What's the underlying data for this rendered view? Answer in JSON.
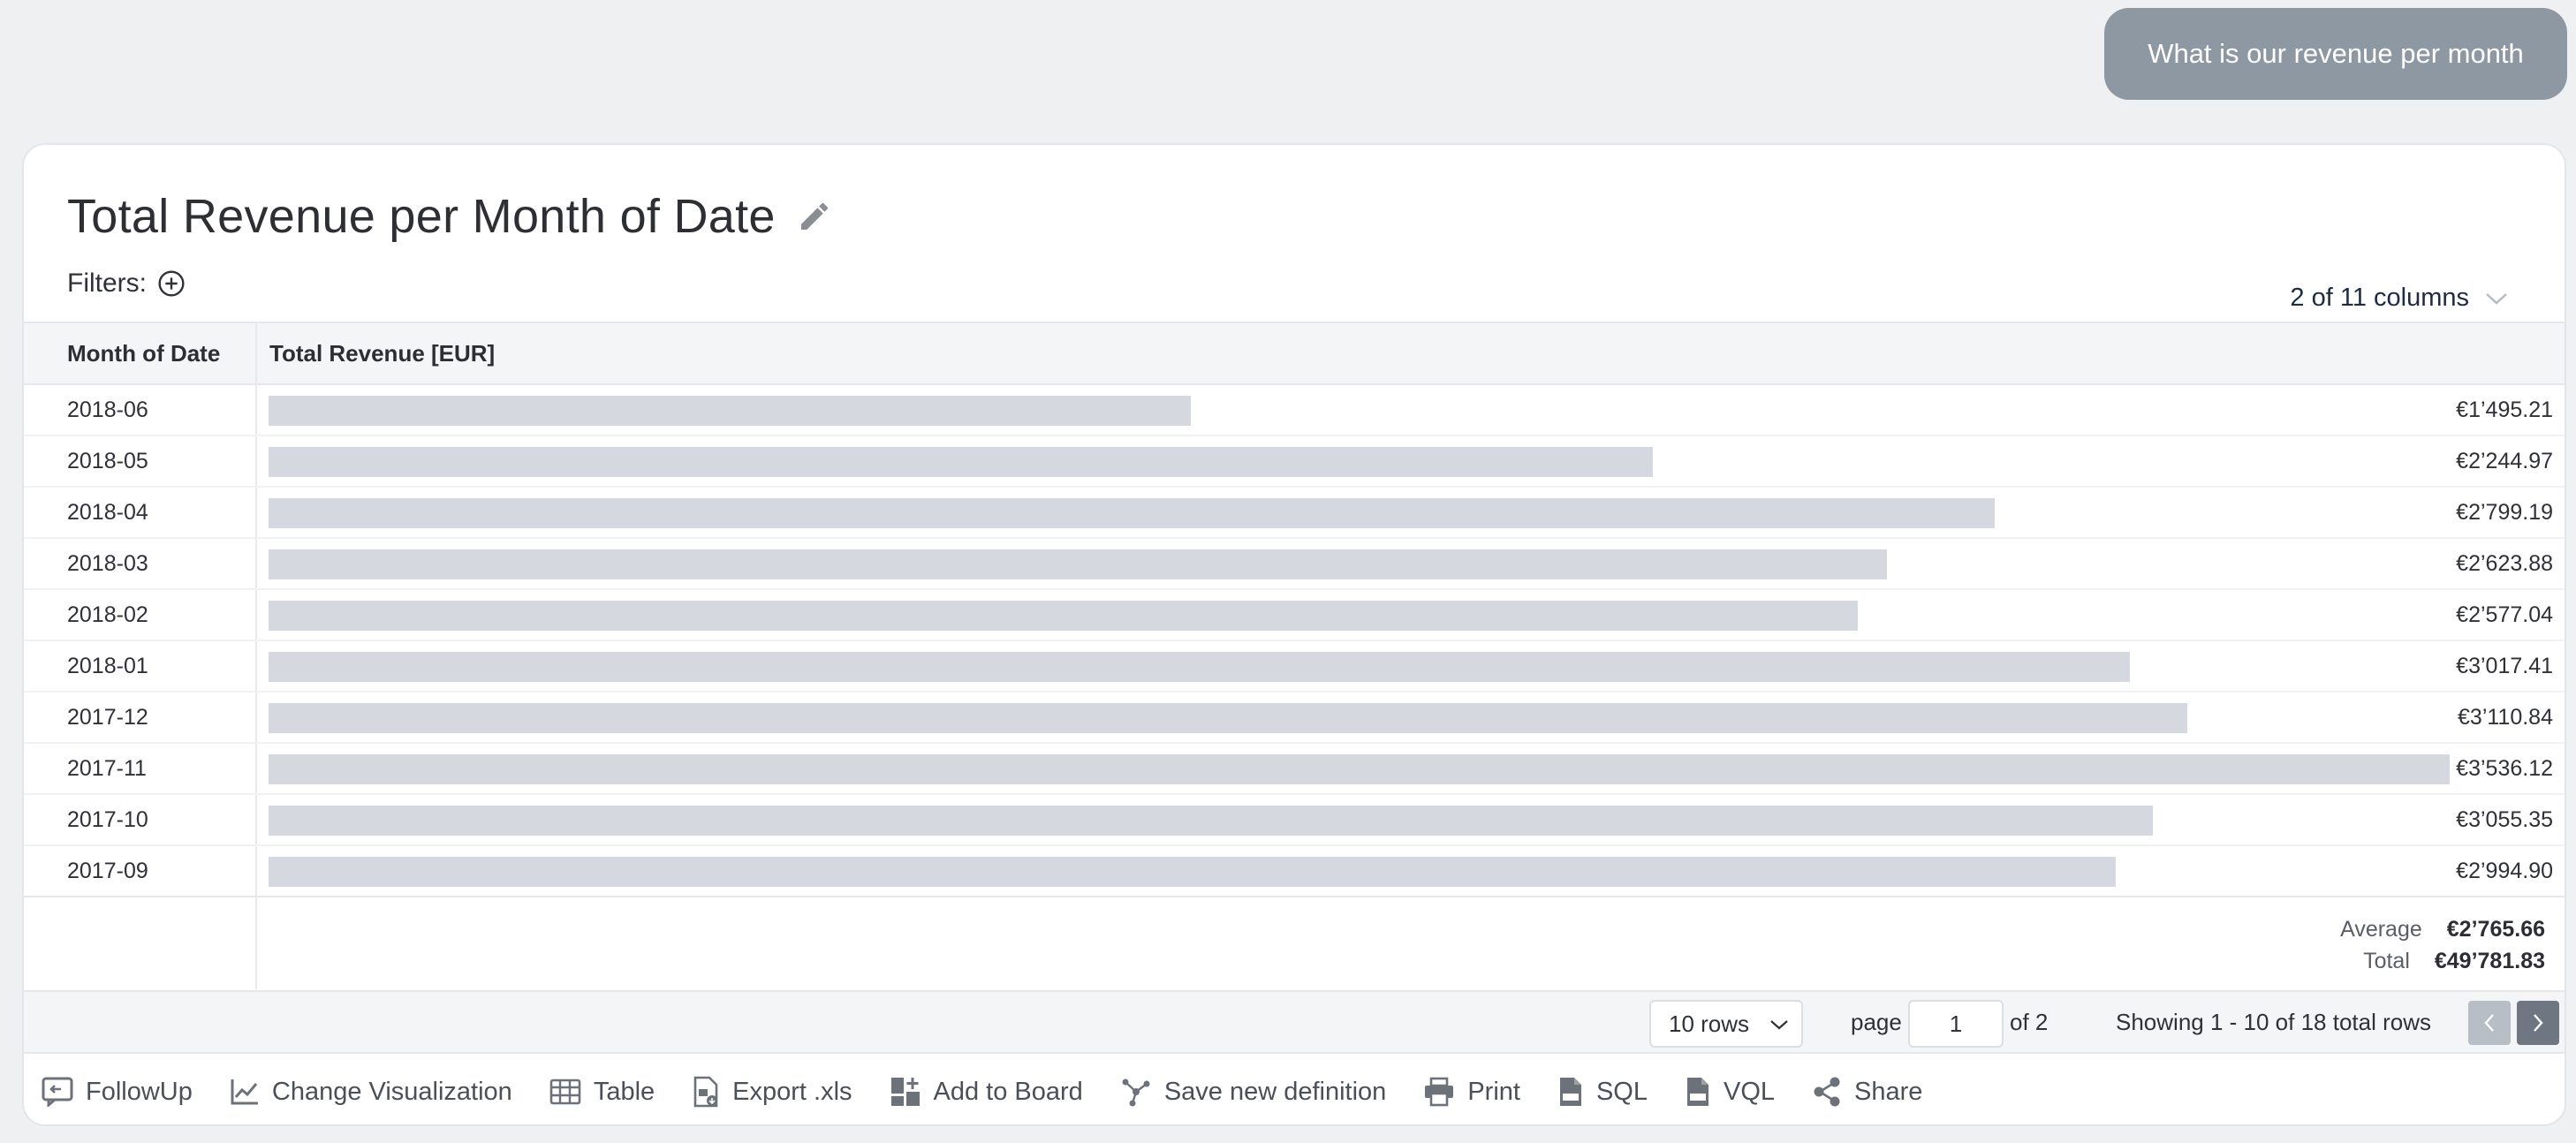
{
  "query": "What is our revenue per month",
  "title": "Total Revenue per Month of Date",
  "filters_label": "Filters:",
  "columns_selector": "2 of 11 columns",
  "table": {
    "columns": [
      "Month of Date",
      "Total Revenue [EUR]"
    ],
    "rows": [
      {
        "month": "2018-06",
        "value": "€1’495.21",
        "amount": 1495.21
      },
      {
        "month": "2018-05",
        "value": "€2’244.97",
        "amount": 2244.97
      },
      {
        "month": "2018-04",
        "value": "€2’799.19",
        "amount": 2799.19
      },
      {
        "month": "2018-03",
        "value": "€2’623.88",
        "amount": 2623.88
      },
      {
        "month": "2018-02",
        "value": "€2’577.04",
        "amount": 2577.04
      },
      {
        "month": "2018-01",
        "value": "€3’017.41",
        "amount": 3017.41
      },
      {
        "month": "2017-12",
        "value": "€3’110.84",
        "amount": 3110.84
      },
      {
        "month": "2017-11",
        "value": "€3’536.12",
        "amount": 3536.12
      },
      {
        "month": "2017-10",
        "value": "€3’055.35",
        "amount": 3055.35
      },
      {
        "month": "2017-09",
        "value": "€2’994.90",
        "amount": 2994.9
      }
    ],
    "summary": {
      "average_label": "Average",
      "average_value": "€2’765.66",
      "total_label": "Total",
      "total_value": "€49’781.83"
    }
  },
  "pagination": {
    "rows_per_page": "10 rows",
    "page_label": "page",
    "page_value": "1",
    "of_label": "of 2",
    "showing": "Showing 1 - 10 of 18 total rows"
  },
  "toolbar": {
    "followup": "FollowUp",
    "change_viz": "Change Visualization",
    "table": "Table",
    "export": "Export .xls",
    "add_board": "Add to Board",
    "save_def": "Save new definition",
    "print": "Print",
    "sql": "SQL",
    "vql": "VQL",
    "share": "Share"
  }
}
